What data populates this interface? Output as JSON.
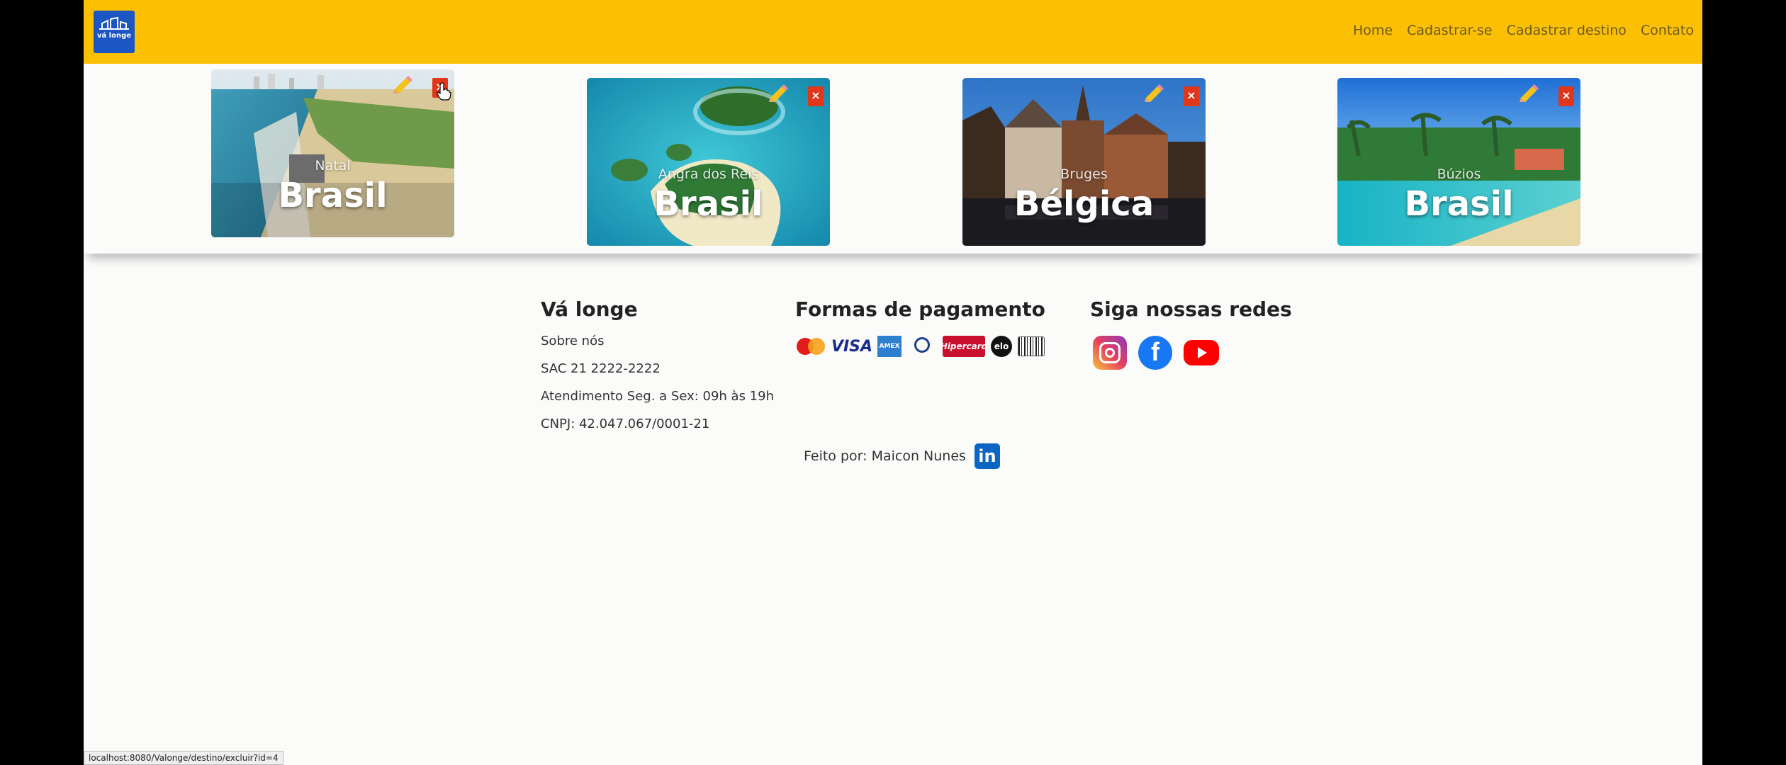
{
  "navbar": {
    "logo_text": "vá longe",
    "links": [
      "Home",
      "Cadastrar-se",
      "Cadastrar destino",
      "Contato"
    ]
  },
  "cards": [
    {
      "city": "Natal",
      "country": "Brasil"
    },
    {
      "city": "Angra dos Reis",
      "country": "Brasil"
    },
    {
      "city": "Bruges",
      "country": "Bélgica"
    },
    {
      "city": "Búzios",
      "country": "Brasil"
    }
  ],
  "footer": {
    "about": {
      "title": "Vá longe",
      "lines": [
        "Sobre nós",
        "SAC 21 2222-2222",
        "Atendimento Seg. a Sex: 09h às 19h",
        "CNPJ: 42.047.067/0001-21"
      ]
    },
    "payment": {
      "title": "Formas de pagamento",
      "methods": [
        "MasterCard",
        "VISA",
        "AMEX",
        "Diners Club International",
        "Hipercard",
        "elo",
        "Boleto Bancário"
      ]
    },
    "social": {
      "title": "Siga nossas redes",
      "networks": [
        "instagram",
        "facebook",
        "youtube"
      ]
    },
    "made_by": "Feito por: Maicon Nunes"
  },
  "status_bar": "localhost:8080/Valonge/destino/excluir?id=4"
}
